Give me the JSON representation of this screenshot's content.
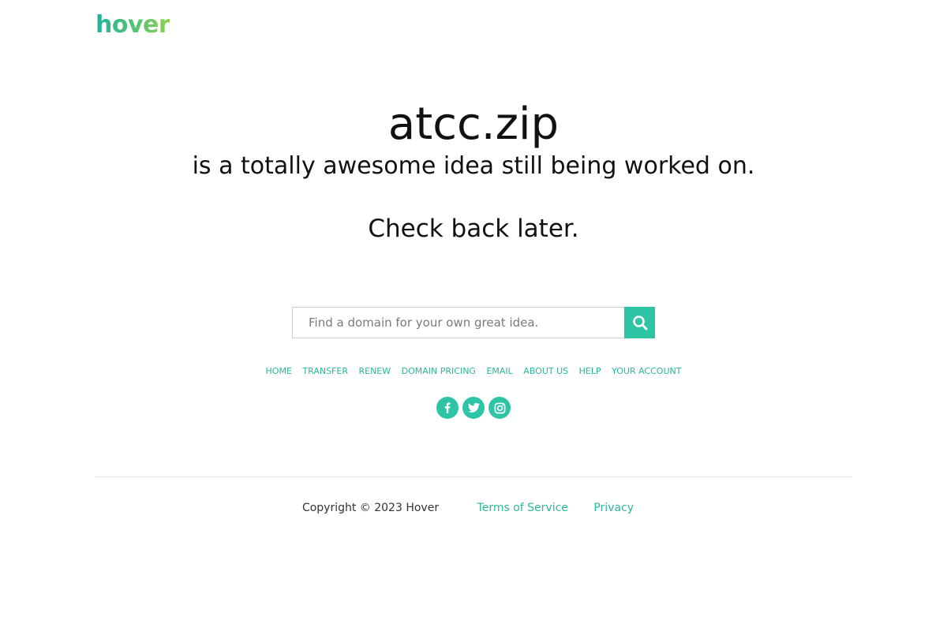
{
  "header": {
    "logo_text": "hover"
  },
  "hero": {
    "domain": "atcc.zip",
    "tagline": "is a totally awesome idea still being worked on.",
    "check_back": "Check back later."
  },
  "search": {
    "placeholder": "Find a domain for your own great idea.",
    "value": "",
    "button_icon": "search-icon"
  },
  "nav": {
    "items": [
      {
        "label": "HOME"
      },
      {
        "label": "TRANSFER"
      },
      {
        "label": "RENEW"
      },
      {
        "label": "DOMAIN PRICING"
      },
      {
        "label": "EMAIL"
      },
      {
        "label": "ABOUT US"
      },
      {
        "label": "HELP"
      },
      {
        "label": "YOUR ACCOUNT"
      }
    ]
  },
  "social": {
    "items": [
      {
        "icon": "facebook-icon"
      },
      {
        "icon": "twitter-icon"
      },
      {
        "icon": "instagram-icon"
      }
    ]
  },
  "footer": {
    "copyright": "Copyright © 2023 Hover",
    "terms": "Terms of Service",
    "privacy": "Privacy"
  },
  "colors": {
    "accent": "#2ec4a6",
    "link": "#2bb79b",
    "text": "#111111"
  }
}
